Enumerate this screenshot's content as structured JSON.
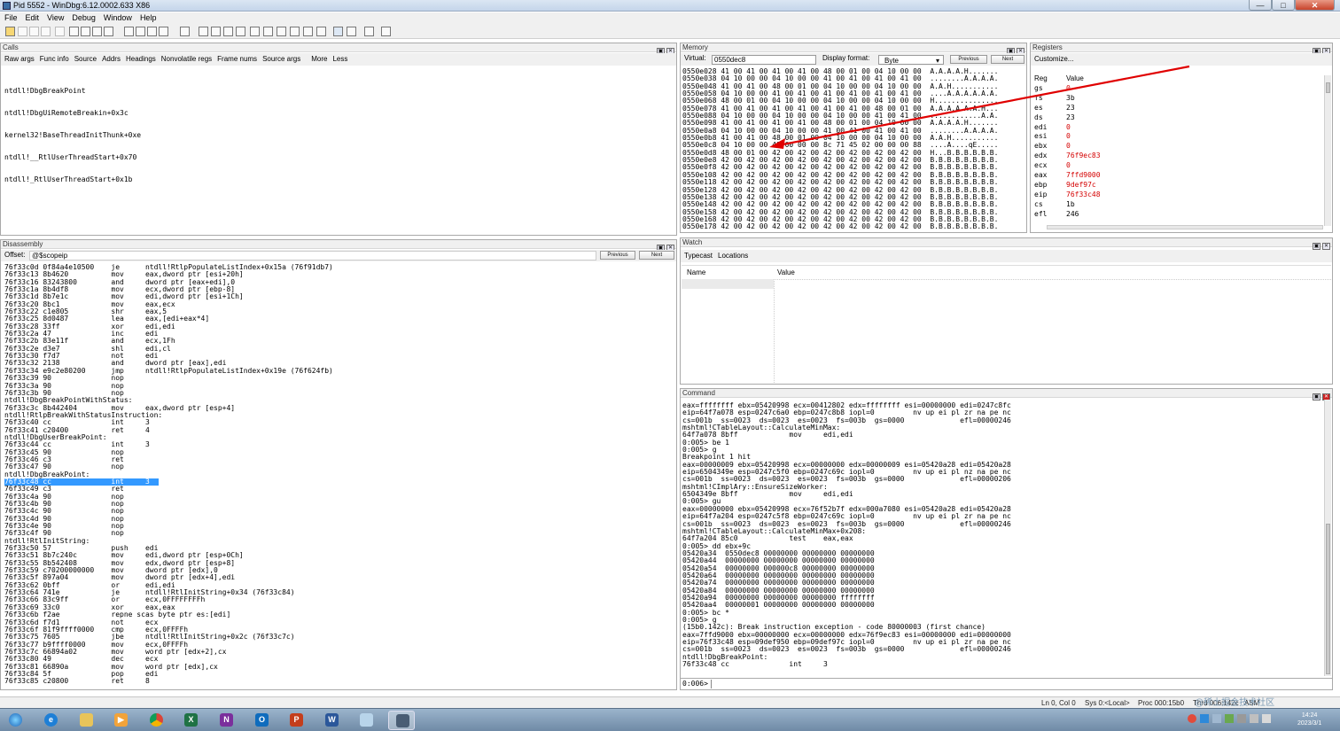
{
  "window": {
    "title": "Pid 5552 - WinDbg:6.12.0002.633 X86",
    "min": "—",
    "max": "□",
    "close": "✕"
  },
  "menu": [
    "File",
    "Edit",
    "View",
    "Debug",
    "Window",
    "Help"
  ],
  "calls": {
    "title": "Calls",
    "buttons": [
      "Raw args",
      "Func info",
      "Source",
      "Addrs",
      "Headings",
      "Nonvolatile regs",
      "Frame nums",
      "Source args",
      "More",
      "Less"
    ],
    "lines": [
      "ntdll!DbgBreakPoint",
      "ntdll!DbgUiRemoteBreakin+0x3c",
      "kernel32!BaseThreadInitThunk+0xe",
      "ntdll!__RtlUserThreadStart+0x70",
      "ntdll!_RtlUserThreadStart+0x1b"
    ]
  },
  "memory": {
    "title": "Memory",
    "virtual_label": "Virtual:",
    "virtual_value": "0550dec8",
    "format_label": "Display format:",
    "format_value": "Byte",
    "previous": "Previous",
    "next": "Next",
    "lines": [
      "0550e028 41 00 41 00 41 00 41 00 48 00 01 00 04 10 00 00  A.A.A.A.H.......",
      "0550e038 04 10 00 00 04 10 00 00 41 00 41 00 41 00 41 00  ........A.A.A.A.",
      "0550e048 41 00 41 00 48 00 01 00 04 10 00 00 04 10 00 00  A.A.H...........",
      "0550e058 04 10 00 00 41 00 41 00 41 00 41 00 41 00 41 00  ....A.A.A.A.A.A.",
      "0550e068 48 00 01 00 04 10 00 00 04 10 00 00 04 10 00 00  H...............",
      "0550e078 41 00 41 00 41 00 41 00 41 00 41 00 48 00 01 00  A.A.A.A.A.A.H...",
      "0550e088 04 10 00 00 04 10 00 00 04 10 00 00 41 00 41 00  ............A.A.",
      "0550e098 41 00 41 00 41 00 41 00 48 00 01 00 04 10 00 00  A.A.A.A.H.......",
      "0550e0a8 04 10 00 00 04 10 00 00 41 00 41 00 41 00 41 00  ........A.A.A.A.",
      "0550e0b8 41 00 41 00 48 00 01 00 04 10 00 00 04 10 00 00  A.A.H...........",
      "0550e0c8 04 10 00 00 41 00 00 00 8c 71 45 02 00 00 00 88  ....A....qE.....",
      "0550e0d8 48 00 01 00 42 00 42 00 42 00 42 00 42 00 42 00  H...B.B.B.B.B.B.",
      "0550e0e8 42 00 42 00 42 00 42 00 42 00 42 00 42 00 42 00  B.B.B.B.B.B.B.B.",
      "0550e0f8 42 00 42 00 42 00 42 00 42 00 42 00 42 00 42 00  B.B.B.B.B.B.B.B.",
      "0550e108 42 00 42 00 42 00 42 00 42 00 42 00 42 00 42 00  B.B.B.B.B.B.B.B.",
      "0550e118 42 00 42 00 42 00 42 00 42 00 42 00 42 00 42 00  B.B.B.B.B.B.B.B.",
      "0550e128 42 00 42 00 42 00 42 00 42 00 42 00 42 00 42 00  B.B.B.B.B.B.B.B.",
      "0550e138 42 00 42 00 42 00 42 00 42 00 42 00 42 00 42 00  B.B.B.B.B.B.B.B.",
      "0550e148 42 00 42 00 42 00 42 00 42 00 42 00 42 00 42 00  B.B.B.B.B.B.B.B.",
      "0550e158 42 00 42 00 42 00 42 00 42 00 42 00 42 00 42 00  B.B.B.B.B.B.B.B.",
      "0550e168 42 00 42 00 42 00 42 00 42 00 42 00 42 00 42 00  B.B.B.B.B.B.B.B.",
      "0550e178 42 00 42 00 42 00 42 00 42 00 42 00 42 00 42 00  B.B.B.B.B.B.B.B."
    ]
  },
  "registers": {
    "title": "Registers",
    "customize": "Customize...",
    "col_reg": "Reg",
    "col_value": "Value",
    "rows": [
      {
        "reg": "gs",
        "value": "0",
        "changed": true
      },
      {
        "reg": "fs",
        "value": "3b",
        "changed": false
      },
      {
        "reg": "es",
        "value": "23",
        "changed": false
      },
      {
        "reg": "ds",
        "value": "23",
        "changed": false
      },
      {
        "reg": "edi",
        "value": "0",
        "changed": true
      },
      {
        "reg": "esi",
        "value": "0",
        "changed": true
      },
      {
        "reg": "ebx",
        "value": "0",
        "changed": true
      },
      {
        "reg": "edx",
        "value": "76f9ec83",
        "changed": true
      },
      {
        "reg": "ecx",
        "value": "0",
        "changed": true
      },
      {
        "reg": "eax",
        "value": "7ffd9000",
        "changed": true
      },
      {
        "reg": "ebp",
        "value": "9def97c",
        "changed": true
      },
      {
        "reg": "eip",
        "value": "76f33c48",
        "changed": true
      },
      {
        "reg": "cs",
        "value": "1b",
        "changed": false
      },
      {
        "reg": "efl",
        "value": "246",
        "changed": false
      }
    ]
  },
  "disassembly": {
    "title": "Disassembly",
    "offset_label": "Offset:",
    "offset_value": "@$scopeip",
    "previous": "Previous",
    "next": "Next",
    "lines": [
      "76f33c0d 0f84a4e10500    je      ntdll!RtlpPopulateListIndex+0x15a (76f91db7)",
      "76f33c13 8b4620          mov     eax,dword ptr [esi+20h]",
      "76f33c16 83243800        and     dword ptr [eax+edi],0",
      "76f33c1a 8b4df8          mov     ecx,dword ptr [ebp-8]",
      "76f33c1d 8b7e1c          mov     edi,dword ptr [esi+1Ch]",
      "76f33c20 8bc1            mov     eax,ecx",
      "76f33c22 c1e805          shr     eax,5",
      "76f33c25 8d0487          lea     eax,[edi+eax*4]",
      "76f33c28 33ff            xor     edi,edi",
      "76f33c2a 47              inc     edi",
      "76f33c2b 83e11f          and     ecx,1Fh",
      "76f33c2e d3e7            shl     edi,cl",
      "76f33c30 f7d7            not     edi",
      "76f33c32 2138            and     dword ptr [eax],edi",
      "76f33c34 e9c2e80200      jmp     ntdll!RtlpPopulateListIndex+0x19e (76f624fb)",
      "76f33c39 90              nop",
      "76f33c3a 90              nop",
      "76f33c3b 90              nop",
      "ntdll!DbgBreakPointWithStatus:",
      "76f33c3c 8b442404        mov     eax,dword ptr [esp+4]",
      "ntdll!RtlpBreakWithStatusInstruction:",
      "76f33c40 cc              int     3",
      "76f33c41 c20400          ret     4",
      "ntdll!DbgUserBreakPoint:",
      "76f33c44 cc              int     3",
      "76f33c45 90              nop",
      "76f33c46 c3              ret",
      "76f33c47 90              nop",
      "ntdll!DbgBreakPoint:",
      "76f33c48 cc              int     3",
      "76f33c49 c3              ret",
      "76f33c4a 90              nop",
      "76f33c4b 90              nop",
      "76f33c4c 90              nop",
      "76f33c4d 90              nop",
      "76f33c4e 90              nop",
      "76f33c4f 90              nop",
      "ntdll!RtlInitString:",
      "76f33c50 57              push    edi",
      "76f33c51 8b7c240c        mov     edi,dword ptr [esp+0Ch]",
      "76f33c55 8b542408        mov     edx,dword ptr [esp+8]",
      "76f33c59 c70200000000    mov     dword ptr [edx],0",
      "76f33c5f 897a04          mov     dword ptr [edx+4],edi",
      "76f33c62 0bff            or      edi,edi",
      "76f33c64 741e            je      ntdll!RtlInitString+0x34 (76f33c84)",
      "76f33c66 83c9ff          or      ecx,0FFFFFFFFh",
      "76f33c69 33c0            xor     eax,eax",
      "76f33c6b f2ae            repne scas byte ptr es:[edi]",
      "76f33c6d f7d1            not     ecx",
      "76f33c6f 81f9ffff0000    cmp     ecx,0FFFFh",
      "76f33c75 7605            jbe     ntdll!RtlInitString+0x2c (76f33c7c)",
      "76f33c77 b9ffff0000      mov     ecx,0FFFFh",
      "76f33c7c 66894a02        mov     word ptr [edx+2],cx",
      "76f33c80 49              dec     ecx",
      "76f33c81 66890a          mov     word ptr [edx],cx",
      "76f33c84 5f              pop     edi",
      "76f33c85 c20800          ret     8"
    ],
    "selected_index": 29
  },
  "watch": {
    "title": "Watch",
    "tabs": [
      "Typecast",
      "Locations"
    ],
    "col_name": "Name",
    "col_value": "Value"
  },
  "command": {
    "title": "Command",
    "lines": [
      "eax=ffffffff ebx=05420998 ecx=00412802 edx=ffffffff esi=00000000 edi=0247c8fc",
      "eip=64f7a078 esp=0247c6a0 ebp=0247c8b8 iopl=0         nv up ei pl zr na pe nc",
      "cs=001b  ss=0023  ds=0023  es=0023  fs=003b  gs=0000             efl=00000246",
      "mshtml!CTableLayout::CalculateMinMax:",
      "64f7a078 8bff            mov     edi,edi",
      "0:005> be 1",
      "0:005> g",
      "Breakpoint 1 hit",
      "eax=00000009 ebx=05420998 ecx=00000000 edx=00000009 esi=05420a28 edi=05420a28",
      "eip=6504349e esp=0247c5f0 ebp=0247c69c iopl=0         nv up ei pl nz na pe nc",
      "cs=001b  ss=0023  ds=0023  es=0023  fs=003b  gs=0000             efl=00000206",
      "mshtml!CImplAry::EnsureSizeWorker:",
      "6504349e 8bff            mov     edi,edi",
      "0:005> gu",
      "eax=00000000 ebx=05420998 ecx=76f52b7f edx=000a7080 esi=05420a28 edi=05420a28",
      "eip=64f7a204 esp=0247c5f8 ebp=0247c69c iopl=0         nv up ei pl zr na pe nc",
      "cs=001b  ss=0023  ds=0023  es=0023  fs=003b  gs=0000             efl=00000246",
      "mshtml!CTableLayout::CalculateMinMax+0x208:",
      "64f7a204 85c0            test    eax,eax",
      "0:005> dd ebx+9c",
      "05420a34  0550dec8 00000000 00000000 00000000",
      "05420a44  00000000 00000000 00000000 00000000",
      "05420a54  00000000 000000c8 00000000 00000000",
      "05420a64  00000000 00000000 00000000 00000000",
      "05420a74  00000000 00000000 00000000 00000000",
      "05420a84  00000000 00000000 00000000 00000000",
      "05420a94  00000000 00000000 00000000 ffffffff",
      "05420aa4  00000001 00000000 00000000 00000000",
      "0:005> bc *",
      "0:005> g",
      "(15b0.142c): Break instruction exception - code 80000003 (first chance)",
      "eax=7ffd9000 ebx=00000000 ecx=00000000 edx=76f9ec83 esi=00000000 edi=00000000",
      "eip=76f33c48 esp=09def950 ebp=09def97c iopl=0         nv up ei pl zr na pe nc",
      "cs=001b  ss=0023  ds=0023  es=0023  fs=003b  gs=0000             efl=00000246",
      "ntdll!DbgBreakPoint:",
      "76f33c48 cc              int     3"
    ],
    "prompt": "0:006>"
  },
  "status": {
    "lncol": "Ln 0, Col 0",
    "sys": "Sys 0:<Local>",
    "proc": "Proc 000:15b0",
    "thrd": "Thrd 006:142c",
    "mode": "ASM"
  },
  "tray": {
    "time": "14:24",
    "date": "2023/3/1",
    "watermark": "@稀土掘金技术社区"
  }
}
